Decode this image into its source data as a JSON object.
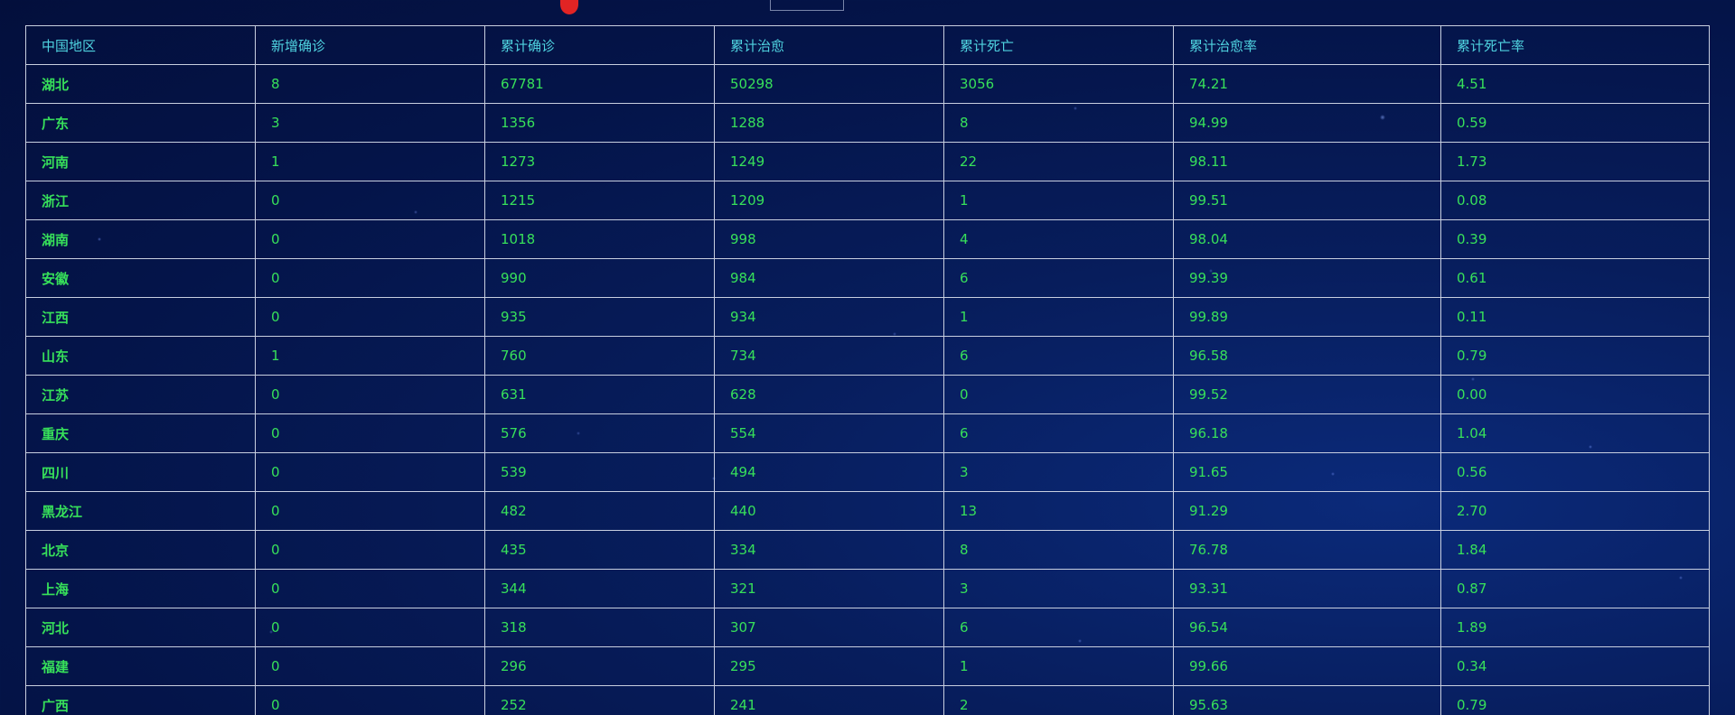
{
  "colors": {
    "header_text": "#4fd3e0",
    "cell_text": "#37e05a",
    "grid_line": "#c8cfe0",
    "background": "#041449",
    "top_marker": "#e22424"
  },
  "table": {
    "headers": [
      "中国地区",
      "新增确诊",
      "累计确诊",
      "累计治愈",
      "累计死亡",
      "累计治愈率",
      "累计死亡率"
    ],
    "rows": [
      [
        "湖北",
        "8",
        "67781",
        "50298",
        "3056",
        "74.21",
        "4.51"
      ],
      [
        "广东",
        "3",
        "1356",
        "1288",
        "8",
        "94.99",
        "0.59"
      ],
      [
        "河南",
        "1",
        "1273",
        "1249",
        "22",
        "98.11",
        "1.73"
      ],
      [
        "浙江",
        "0",
        "1215",
        "1209",
        "1",
        "99.51",
        "0.08"
      ],
      [
        "湖南",
        "0",
        "1018",
        "998",
        "4",
        "98.04",
        "0.39"
      ],
      [
        "安徽",
        "0",
        "990",
        "984",
        "6",
        "99.39",
        "0.61"
      ],
      [
        "江西",
        "0",
        "935",
        "934",
        "1",
        "99.89",
        "0.11"
      ],
      [
        "山东",
        "1",
        "760",
        "734",
        "6",
        "96.58",
        "0.79"
      ],
      [
        "江苏",
        "0",
        "631",
        "628",
        "0",
        "99.52",
        "0.00"
      ],
      [
        "重庆",
        "0",
        "576",
        "554",
        "6",
        "96.18",
        "1.04"
      ],
      [
        "四川",
        "0",
        "539",
        "494",
        "3",
        "91.65",
        "0.56"
      ],
      [
        "黑龙江",
        "0",
        "482",
        "440",
        "13",
        "91.29",
        "2.70"
      ],
      [
        "北京",
        "0",
        "435",
        "334",
        "8",
        "76.78",
        "1.84"
      ],
      [
        "上海",
        "0",
        "344",
        "321",
        "3",
        "93.31",
        "0.87"
      ],
      [
        "河北",
        "0",
        "318",
        "307",
        "6",
        "96.54",
        "1.89"
      ],
      [
        "福建",
        "0",
        "296",
        "295",
        "1",
        "99.66",
        "0.34"
      ],
      [
        "广西",
        "0",
        "252",
        "241",
        "2",
        "95.63",
        "0.79"
      ]
    ]
  }
}
